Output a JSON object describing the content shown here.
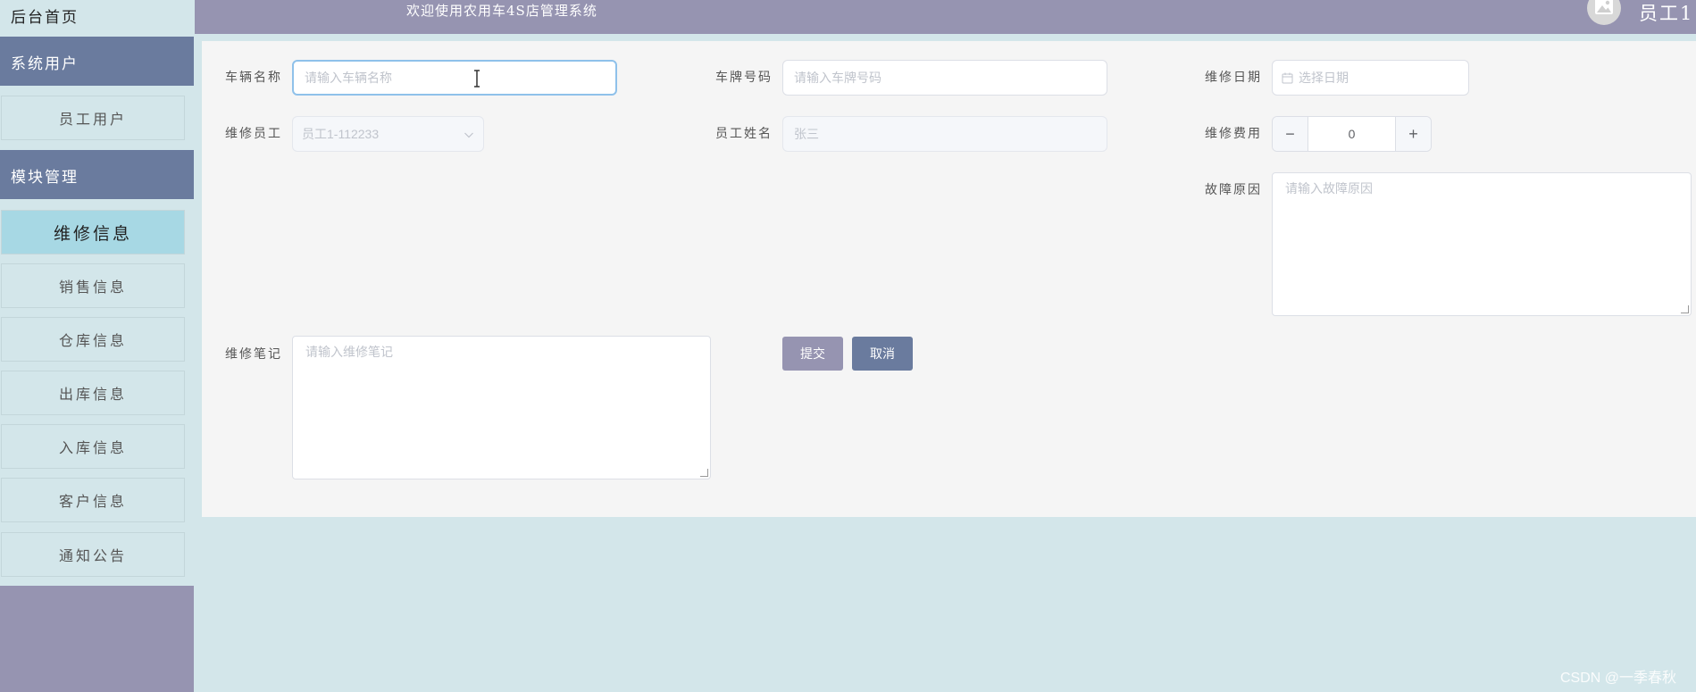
{
  "sidebar": {
    "home": "后台首页",
    "groups": [
      {
        "label": "系统用户",
        "items": [
          {
            "label": "员工用户"
          }
        ]
      },
      {
        "label": "模块管理",
        "items": [
          {
            "label": "维修信息",
            "active": true
          },
          {
            "label": "销售信息"
          },
          {
            "label": "仓库信息"
          },
          {
            "label": "出库信息"
          },
          {
            "label": "入库信息"
          },
          {
            "label": "客户信息"
          },
          {
            "label": "通知公告"
          }
        ]
      }
    ]
  },
  "header": {
    "title": "欢迎使用农用车4S店管理系统",
    "user": "员工1"
  },
  "form": {
    "vehicle_name": {
      "label": "车辆名称",
      "placeholder": "请输入车辆名称"
    },
    "plate_number": {
      "label": "车牌号码",
      "placeholder": "请输入车牌号码"
    },
    "repair_date": {
      "label": "维修日期",
      "placeholder": "选择日期"
    },
    "repair_staff": {
      "label": "维修员工",
      "value": "员工1-112233"
    },
    "staff_name": {
      "label": "员工姓名",
      "value": "张三"
    },
    "repair_cost": {
      "label": "维修费用",
      "value": "0",
      "minus": "−",
      "plus": "+"
    },
    "fault_reason": {
      "label": "故障原因",
      "placeholder": "请输入故障原因"
    },
    "repair_notes": {
      "label": "维修笔记",
      "placeholder": "请输入维修笔记"
    },
    "submit": "提交",
    "cancel": "取消"
  },
  "colors": {
    "sidebar_bg": "#9694b1",
    "group_bg": "#6a7b9e",
    "item_bg": "#d3e6ea",
    "active_item_bg": "#a7d8e4",
    "submit_bg": "#9694b1",
    "cancel_bg": "#6a7b9e"
  },
  "watermark": "CSDN @一季春秋"
}
